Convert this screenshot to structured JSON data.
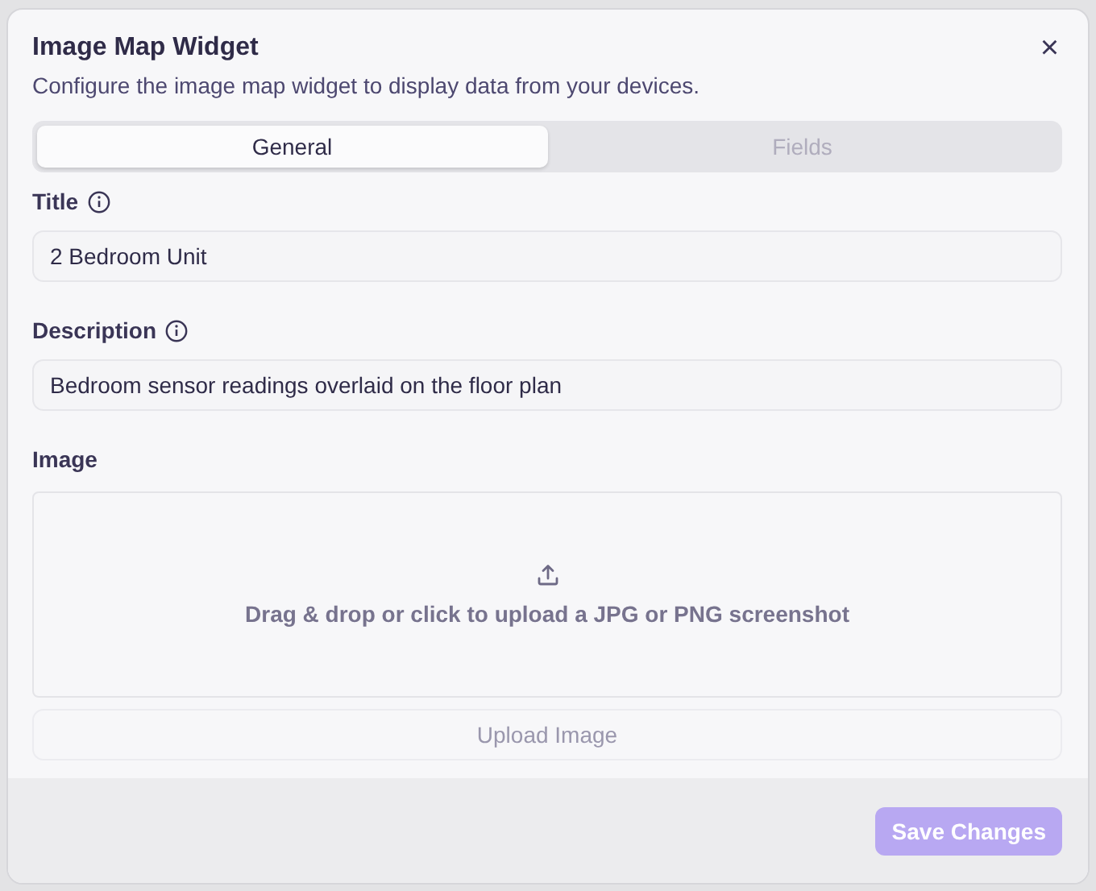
{
  "dialog": {
    "title": "Image Map Widget",
    "description": "Configure the image map widget to display data from your devices.",
    "close": "×"
  },
  "tabs": [
    {
      "label": "General",
      "selected": true
    },
    {
      "label": "Fields",
      "selected": false
    }
  ],
  "fields": [
    {
      "label": "Title",
      "value": "2 Bedroom Unit",
      "info": true
    },
    {
      "label": "Description",
      "value": "Bedroom sensor readings overlaid on the floor plan",
      "info": true
    }
  ],
  "image": {
    "label": "Image",
    "dropzone_text": "Drag & drop or click to upload a JPG or PNG screenshot",
    "upload_button": {
      "label": "Upload Image",
      "disabled": true
    }
  },
  "footer": {
    "save_button": {
      "label": "Save Changes",
      "disabled": true
    }
  }
}
